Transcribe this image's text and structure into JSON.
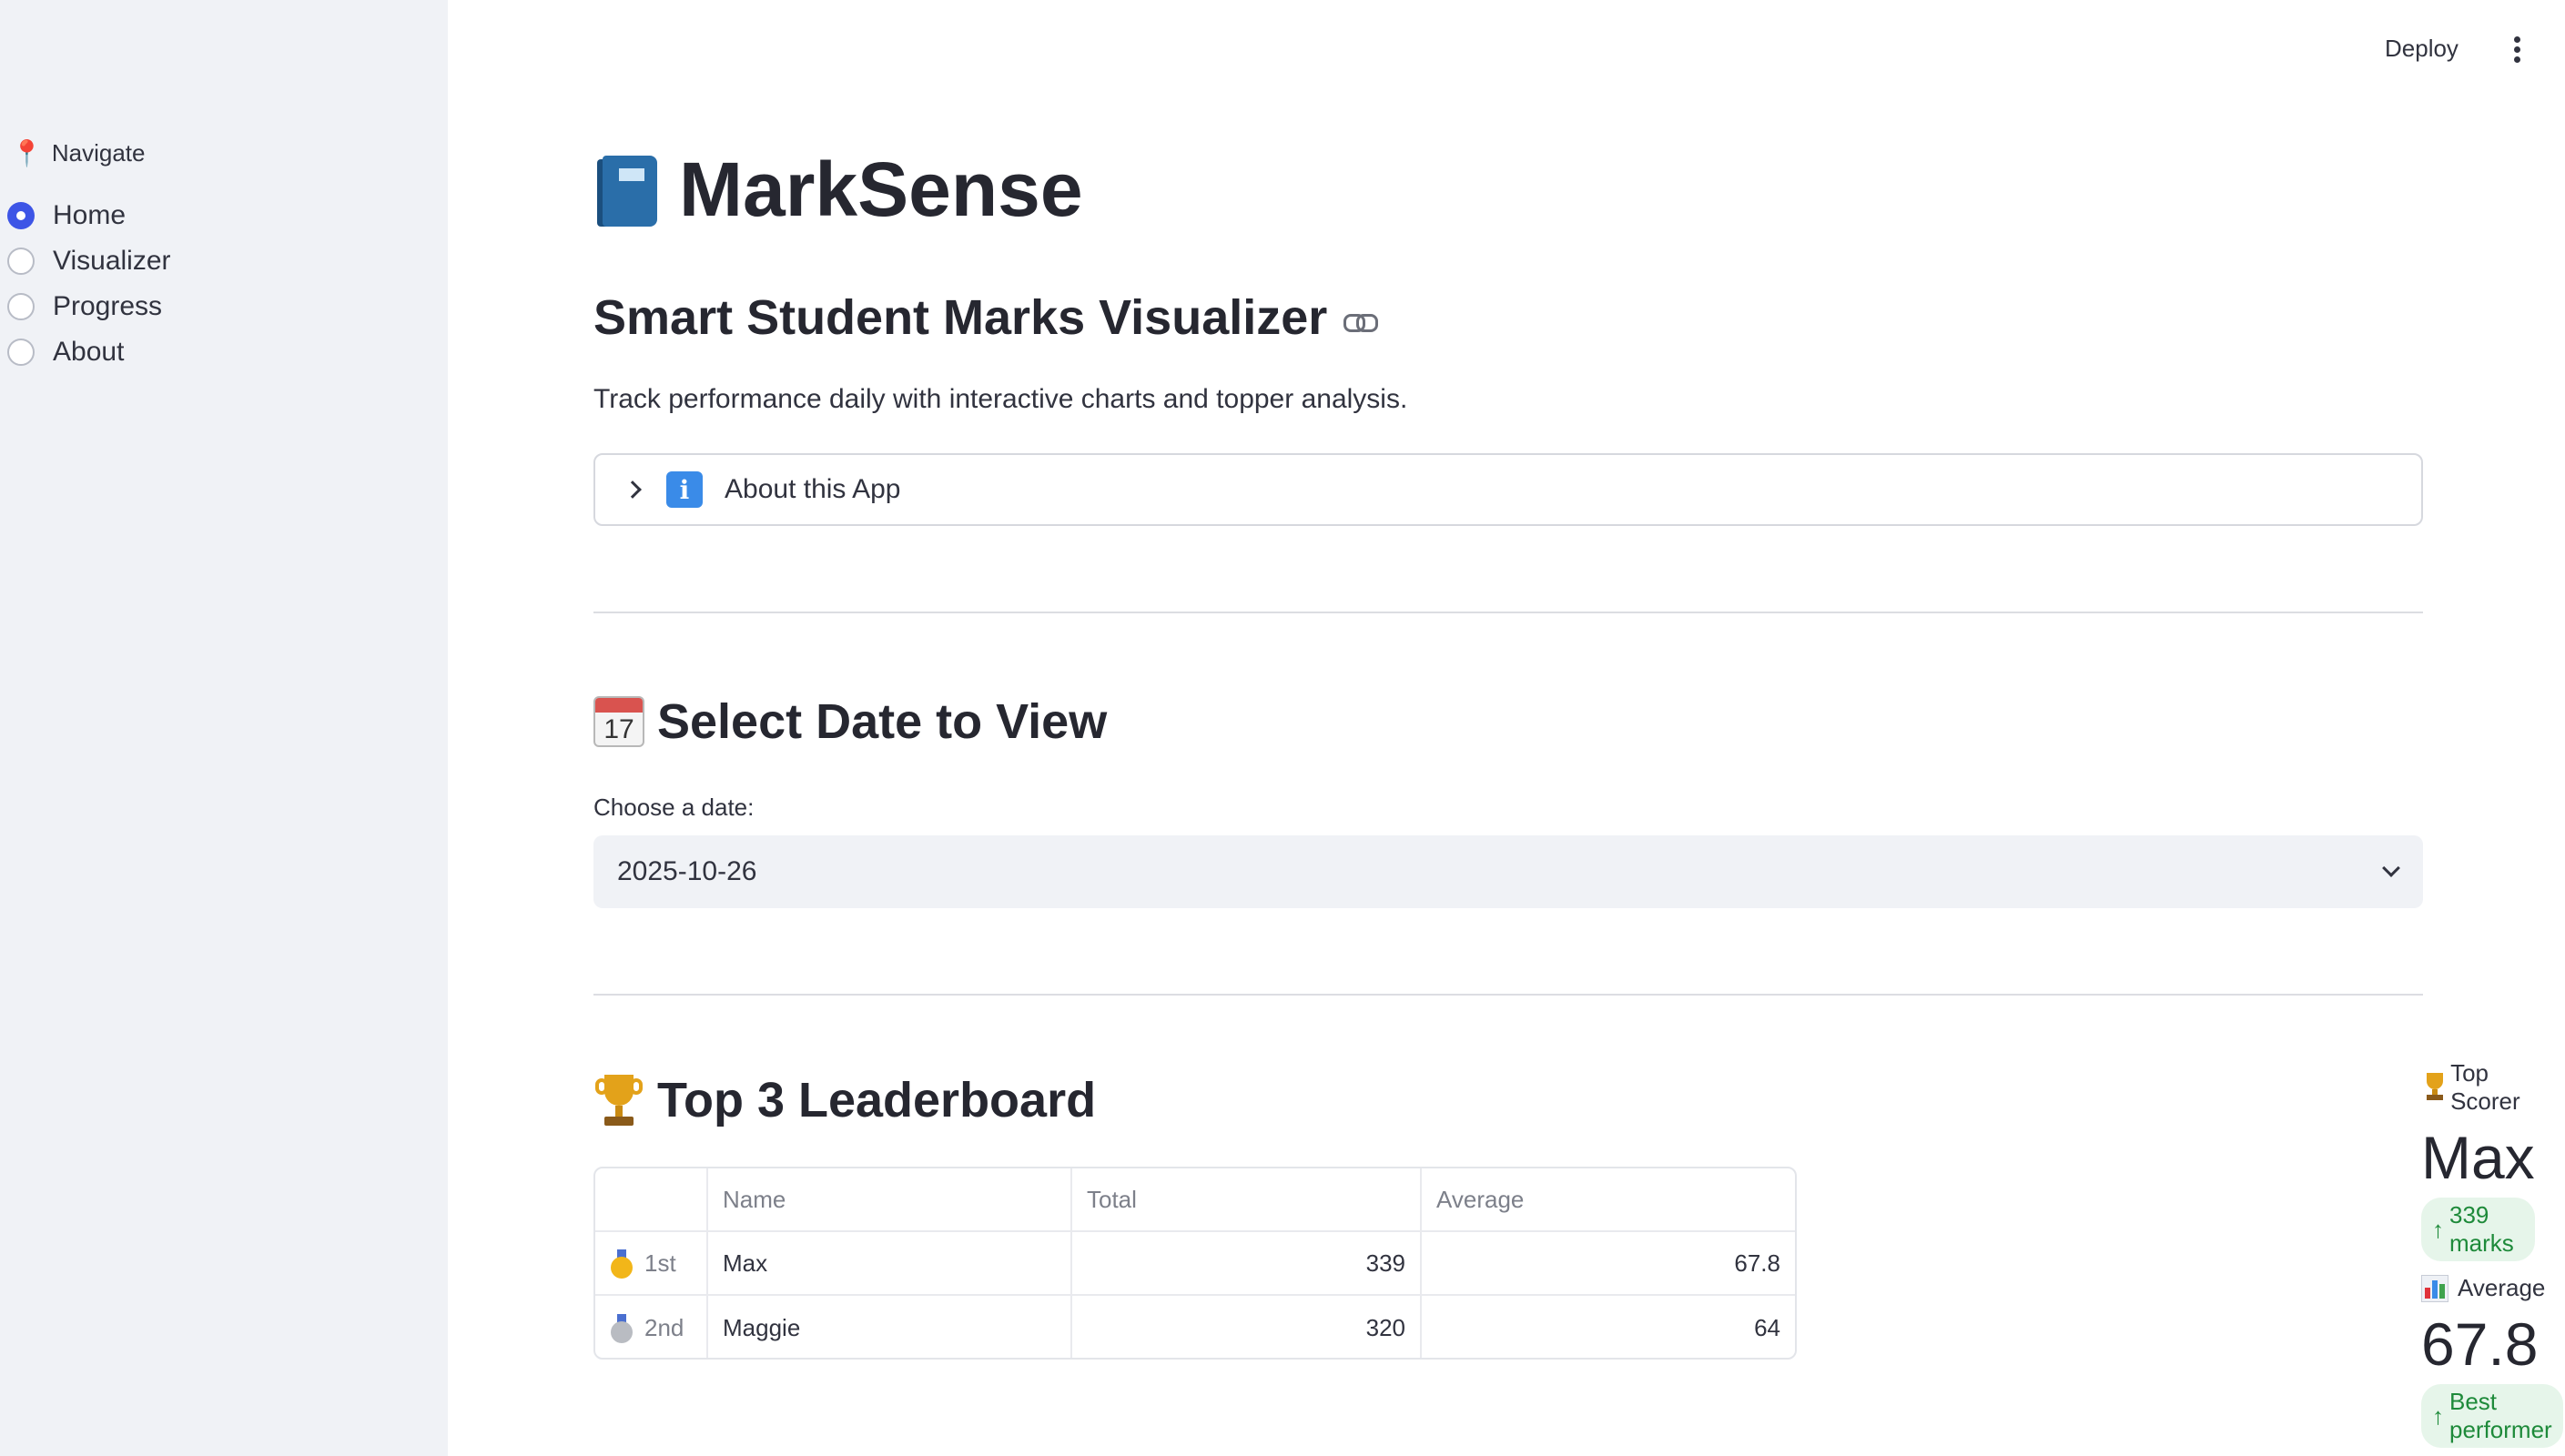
{
  "header": {
    "deploy_label": "Deploy"
  },
  "sidebar": {
    "nav_label": "Navigate",
    "items": [
      {
        "label": "Home",
        "selected": true
      },
      {
        "label": "Visualizer",
        "selected": false
      },
      {
        "label": "Progress",
        "selected": false
      },
      {
        "label": "About",
        "selected": false
      }
    ]
  },
  "main": {
    "title": "MarkSense",
    "subtitle": "Smart Student Marks Visualizer",
    "description": "Track performance daily with interactive charts and topper analysis.",
    "expander_label": "About this App",
    "date_section": {
      "heading": "Select Date to View",
      "calendar_day": "17",
      "field_label": "Choose a date:",
      "selected_date": "2025-10-26"
    },
    "leaderboard": {
      "heading": "Top 3 Leaderboard",
      "columns": [
        "",
        "Name",
        "Total",
        "Average"
      ],
      "rows": [
        {
          "rank": "1st",
          "name": "Max",
          "total": "339",
          "average": "67.8"
        },
        {
          "rank": "2nd",
          "name": "Maggie",
          "total": "320",
          "average": "64"
        }
      ]
    },
    "metrics": {
      "top_scorer": {
        "label": "Top Scorer",
        "value": "Max",
        "delta": "339 marks"
      },
      "average": {
        "label": "Average",
        "value": "67.8",
        "delta": "Best performer"
      }
    }
  },
  "colors": {
    "accent": "#3d55e6",
    "sidebar_bg": "#f0f2f6",
    "delta_green": "#1e8a3a",
    "delta_bg": "#e6f5ea"
  }
}
